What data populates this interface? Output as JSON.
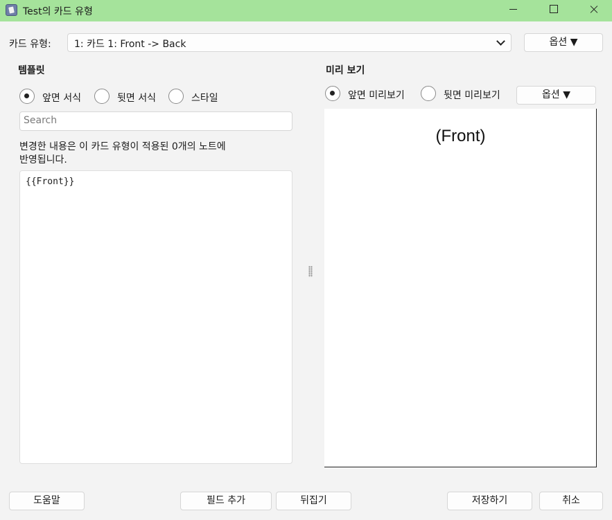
{
  "window": {
    "title": "Test의 카드 유형"
  },
  "header": {
    "card_type_label": "카드 유형:",
    "card_type_value": "1: 카드 1: Front -> Back",
    "options_button": "옵션 ▼"
  },
  "template": {
    "heading": "템플릿",
    "radios": [
      {
        "label": "앞면 서식",
        "checked": true
      },
      {
        "label": "뒷면 서식",
        "checked": false
      },
      {
        "label": "스타일",
        "checked": false
      }
    ],
    "search_placeholder": "Search",
    "notice_line1": "변경한 내용은 이 카드 유형이 적용된 0개의 노트에",
    "notice_line2": "반영됩니다.",
    "editor_content": "{{Front}}"
  },
  "preview": {
    "heading": "미리 보기",
    "radios": [
      {
        "label": "앞면 미리보기",
        "checked": true
      },
      {
        "label": "뒷면 미리보기",
        "checked": false
      }
    ],
    "options_button": "옵션 ▼",
    "rendered_text": "(Front)"
  },
  "footer": {
    "help": "도움말",
    "add_field": "필드 추가",
    "flip": "뒤집기",
    "save": "저장하기",
    "cancel": "취소"
  },
  "colors": {
    "titlebar": "#a5e39b",
    "background": "#f3f3f3"
  }
}
